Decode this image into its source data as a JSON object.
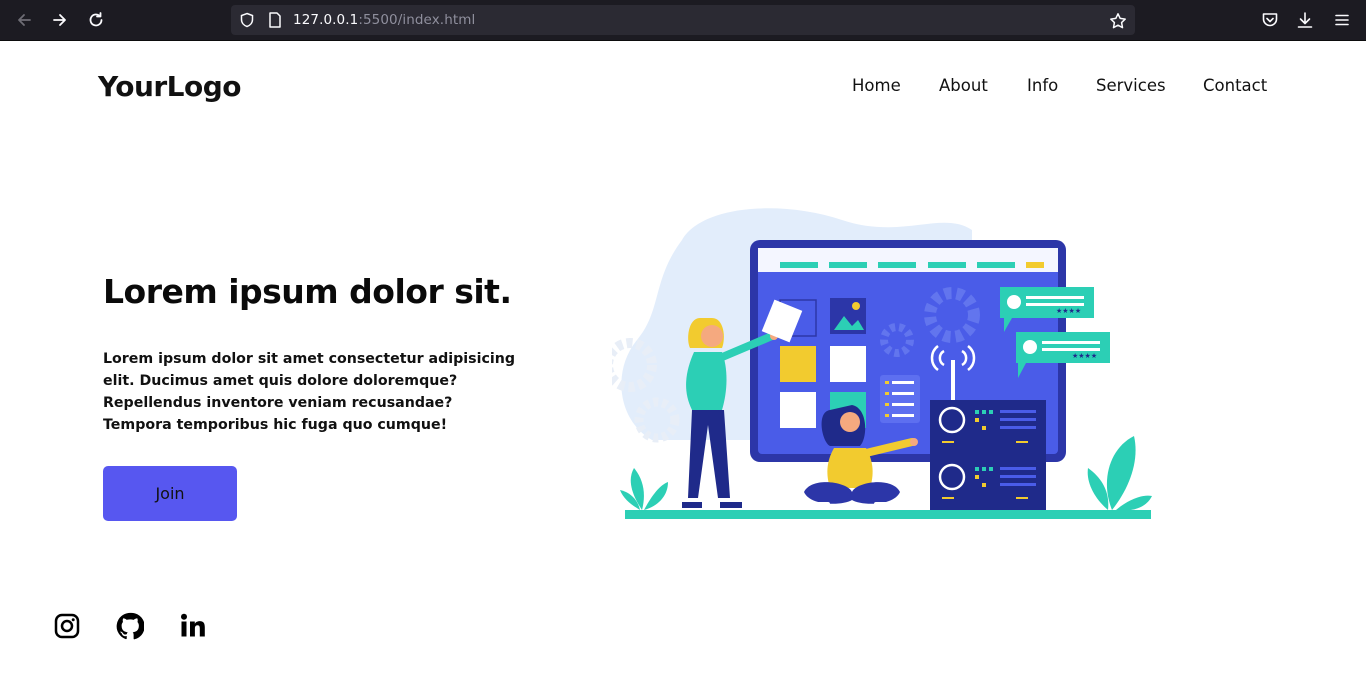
{
  "browser": {
    "url_host": "127.0.0.1",
    "url_rest": ":5500/index.html"
  },
  "header": {
    "logo": "YourLogo",
    "nav": [
      {
        "label": "Home"
      },
      {
        "label": "About"
      },
      {
        "label": "Info"
      },
      {
        "label": "Services"
      },
      {
        "label": "Contact"
      }
    ]
  },
  "hero": {
    "title": "Lorem ipsum dolor sit.",
    "text": "Lorem ipsum dolor sit amet consectetur adipisicing elit. Ducimus amet quis dolore doloremque? Repellendus inventore veniam recusandae? Tempora temporibus hic fuga quo cumque!",
    "button_label": "Join"
  },
  "social": [
    {
      "icon": "instagram-icon"
    },
    {
      "icon": "github-icon"
    },
    {
      "icon": "linkedin-icon"
    }
  ],
  "colors": {
    "button": "#5757f0",
    "illustration_primary": "#4a5ce8",
    "illustration_accent": "#2ccfb5",
    "illustration_yellow": "#f2cb2f",
    "browser_bg": "#1c1b22"
  }
}
